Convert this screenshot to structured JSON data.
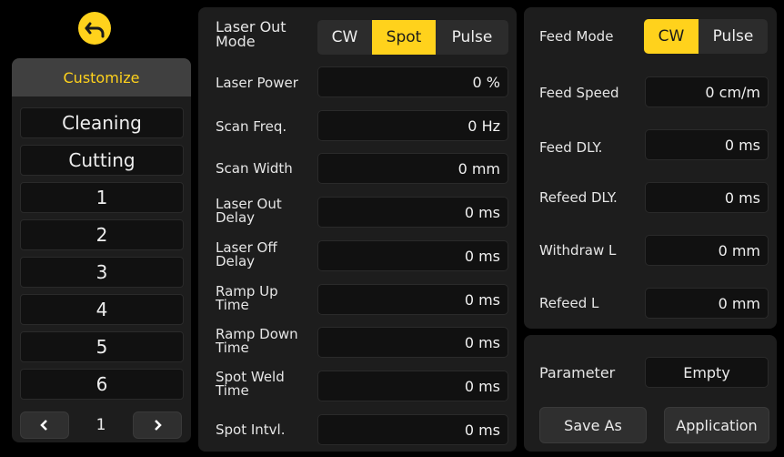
{
  "sidebar": {
    "header": "Customize",
    "items": [
      "Cleaning",
      "Cutting",
      "1",
      "2",
      "3",
      "4",
      "5",
      "6"
    ],
    "page": "1"
  },
  "laser": {
    "mode_label": "Laser Out Mode",
    "mode_options": [
      "CW",
      "Spot",
      "Pulse"
    ],
    "mode_selected": "Spot",
    "rows": [
      {
        "label": "Laser Power",
        "value": "0 %"
      },
      {
        "label": "Scan Freq.",
        "value": "0 Hz"
      },
      {
        "label": "Scan Width",
        "value": "0 mm"
      },
      {
        "label": "Laser Out Delay",
        "value": "0 ms"
      },
      {
        "label": "Laser Off Delay",
        "value": "0 ms"
      },
      {
        "label": "Ramp Up Time",
        "value": "0 ms"
      },
      {
        "label": "Ramp Down Time",
        "value": "0 ms"
      },
      {
        "label": "Spot Weld Time",
        "value": "0 ms"
      },
      {
        "label": "Spot Intvl.",
        "value": "0 ms"
      }
    ]
  },
  "feed": {
    "mode_label": "Feed Mode",
    "mode_options": [
      "CW",
      "Pulse"
    ],
    "mode_selected": "CW",
    "rows": [
      {
        "label": "Feed Speed",
        "value": "0 cm/m"
      },
      {
        "label": "Feed DLY.",
        "value": "0 ms"
      },
      {
        "label": "Refeed DLY.",
        "value": "0 ms"
      },
      {
        "label": "Withdraw L",
        "value": "0 mm"
      },
      {
        "label": "Refeed L",
        "value": "0 mm"
      }
    ]
  },
  "param": {
    "label": "Parameter",
    "value": "Empty",
    "save_as": "Save As",
    "application": "Application"
  },
  "colors": {
    "accent": "#ffd21c",
    "panel": "#1d1d1d",
    "field": "#111111"
  }
}
